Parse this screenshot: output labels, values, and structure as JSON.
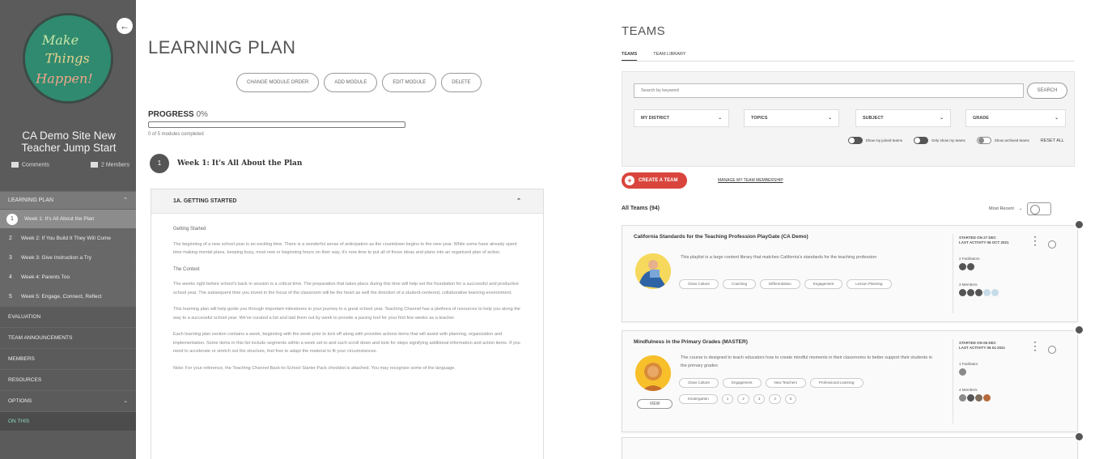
{
  "sidebar": {
    "logo_text": [
      "Make",
      "Things",
      "Happen!"
    ],
    "site_title": "CA Demo Site New Teacher Jump Start",
    "meta_comments": "Comments",
    "meta_members": "2 Members",
    "section_learning_plan": "LEARNING PLAN",
    "weeks": [
      {
        "num": "1",
        "label": "Week 1: It's All About the Plan",
        "current": true
      },
      {
        "num": "2",
        "label": "Week 2: If You Build It They Will Come",
        "current": false
      },
      {
        "num": "3",
        "label": "Week 3: Give Instruction a Try",
        "current": false
      },
      {
        "num": "4",
        "label": "Week 4: Parents Too",
        "current": false
      },
      {
        "num": "5",
        "label": "Week 5: Engage, Connect, Reflect",
        "current": false
      }
    ],
    "links": [
      "EVALUATION",
      "TEAM ANNOUNCEMENTS",
      "MEMBERS",
      "RESOURCES",
      "OPTIONS"
    ],
    "bottom": "ON THIS"
  },
  "learning_plan": {
    "title": "LEARNING PLAN",
    "actions": [
      "CHANGE MODULE ORDER",
      "ADD MODULE",
      "EDIT MODULE",
      "DELETE"
    ],
    "progress_label": "PROGRESS",
    "progress_value": "0%",
    "progress_fraction": 0,
    "progress_sub": "0 of 5 modules completed",
    "week_num": "1",
    "week_title": "Week 1: It's All About the Plan",
    "module_title": "1A. GETTING STARTED",
    "module_body": {
      "h1": "Getting Started",
      "p1": "The beginning of a new school year is an exciting time. There is a wonderful sense of anticipation as the countdown begins to the new year. While some have already spent time making mental plans, keeping busy, most new or beginning hours on their way, it's now time to put all of those ideas and plans into an organized plan of action.",
      "h2": "The Context",
      "p2": "The weeks right before school's back in session is a critical time. The preparation that takes place during this time will help set the foundation for a successful and productive school year. The subsequent time you invest in the focus of the classroom will be the heart as well the direction of a student-centered, collaborative learning environment.",
      "p3": "This learning plan will help guide you through important milestones in your journey to a great school year. Teaching Channel has a plethora of resources to help you along the way to a successful school year. We've curated a list and laid them out by week to provide a pacing tool for your first few weeks as a teacher.",
      "p4": "Each learning plan section contains a week, beginning with the week prior to kick off along with provides actions items that will assist with planning, organization and implementation. Some items in this list include segments within a week set to and such scroll down and look for steps signifying additional information and action items. If you need to accelerate or stretch out the structure, feel free to adapt the material to fit your circumstances.",
      "p5": "Note: For your reference, the Teaching Channel Back-to-School Starter Pack checklist is attached. You may recognize some of the language."
    }
  },
  "teams": {
    "title": "TEAMS",
    "tabs": [
      "TEAMS",
      "TEAM LIBRARY"
    ],
    "search_placeholder": "Search by keyword",
    "search_button": "SEARCH",
    "dropdowns": [
      "MY DISTRICT",
      "TOPICS",
      "SUBJECT",
      "GRADE"
    ],
    "toggles": [
      "Show my joined teams",
      "Only show my teams",
      "Show archived teams"
    ],
    "reset": "RESET ALL",
    "create_button": "CREATE A TEAM",
    "manage_link": "MANAGE MY TEAM MEMBERSHIP",
    "all_teams_label": "All Teams (94)",
    "sort_label": "Most Recent",
    "cards": [
      {
        "title": "California Standards for the Teaching Profession PlayGate (CA Demo)",
        "desc": "This playlist is a large content library that matches California's standards for the teaching profession",
        "chips": [
          "Class Culture",
          "Coaching",
          "Differentiation",
          "Engagement",
          "Lesson Planning"
        ],
        "meta_started": "STARTED ON 27 DEC",
        "meta_activity": "LAST ACTIVITY 06 OCT 2021",
        "facilitators_label": "2 Facilitators",
        "members_label": "3 Members"
      },
      {
        "title": "Mindfulness in the Primary Grades (MASTER)",
        "desc": "The course is designed to teach educators how to create mindful moments in their classrooms to better support their students in the primary grades",
        "chips": [
          "Class Culture",
          "Engagement",
          "New Teachers",
          "Professional Learning"
        ],
        "chips2": [
          "Kindergarten",
          "1",
          "2",
          "3",
          "4",
          "5"
        ],
        "view_label": "VIEW",
        "meta_started": "STARTED ON 06 DEC",
        "meta_activity": "LAST ACTIVITY 06 04 2021",
        "facilitators_label": "1 Facilitator",
        "members_label": "4 Members"
      }
    ]
  },
  "colors": {
    "accent_green": "#2f8a6f",
    "create_red": "#d9453c",
    "sidebar_gray": "#5b5b5b"
  }
}
